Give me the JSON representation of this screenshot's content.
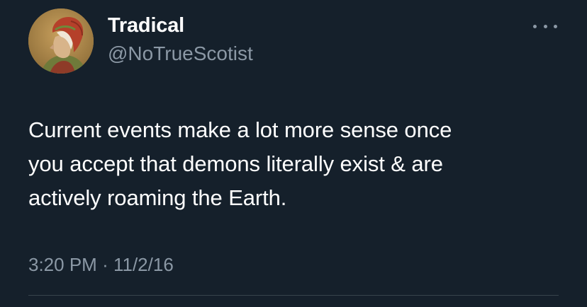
{
  "tweet": {
    "author": {
      "display_name": "Tradical",
      "handle": "@NoTrueScotist",
      "avatar": "medieval-portrait-avatar"
    },
    "more_icon": "ellipsis-icon",
    "text_lines": [
      "Current events make a lot more sense once",
      "you accept that demons literally exist & are",
      "actively roaming the Earth."
    ],
    "time": "3:20 PM",
    "separator": "·",
    "date": "11/2/16"
  },
  "colors": {
    "background": "#15202b",
    "text": "#ffffff",
    "secondary_text": "#8b98a5",
    "divider": "#38444d"
  }
}
